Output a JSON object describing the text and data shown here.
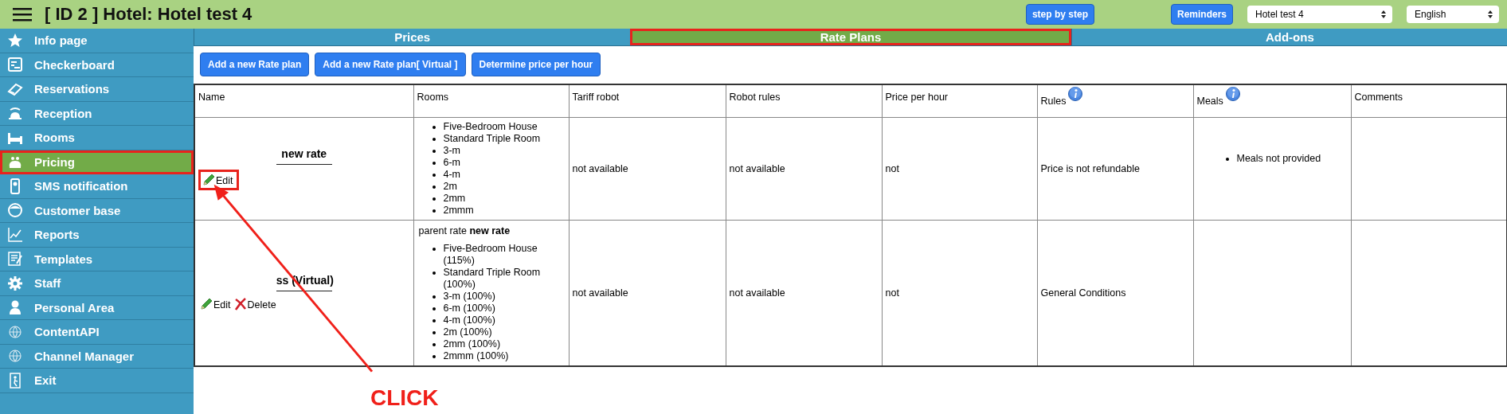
{
  "header": {
    "title": "[ ID 2 ] Hotel: Hotel test 4",
    "buttons": [
      {
        "label": "step by step"
      },
      {
        "label": "Reminders"
      }
    ],
    "selects": [
      {
        "value": "Hotel test 4"
      },
      {
        "value": "English"
      }
    ]
  },
  "sidebar": {
    "items": [
      {
        "label": "Info page",
        "selected": false,
        "highlighted": false
      },
      {
        "label": "Checkerboard",
        "selected": false,
        "highlighted": false
      },
      {
        "label": "Reservations",
        "selected": false,
        "highlighted": false
      },
      {
        "label": "Reception",
        "selected": false,
        "highlighted": false
      },
      {
        "label": "Rooms",
        "selected": false,
        "highlighted": false
      },
      {
        "label": "Pricing",
        "selected": true,
        "highlighted": true
      },
      {
        "label": "SMS notification",
        "selected": false,
        "highlighted": false
      },
      {
        "label": "Customer base",
        "selected": false,
        "highlighted": false
      },
      {
        "label": "Reports",
        "selected": false,
        "highlighted": false
      },
      {
        "label": "Templates",
        "selected": false,
        "highlighted": false
      },
      {
        "label": "Staff",
        "selected": false,
        "highlighted": false
      },
      {
        "label": "Personal Area",
        "selected": false,
        "highlighted": false
      },
      {
        "label": "ContentAPI",
        "selected": false,
        "highlighted": false
      },
      {
        "label": "Channel Manager",
        "selected": false,
        "highlighted": false
      },
      {
        "label": "Exit",
        "selected": false,
        "highlighted": false
      }
    ]
  },
  "tabs": [
    {
      "label": "Prices",
      "selected": false,
      "highlighted": false
    },
    {
      "label": "Rate Plans",
      "selected": true,
      "highlighted": true
    },
    {
      "label": "Add-ons",
      "selected": false,
      "highlighted": false
    }
  ],
  "toolbar": {
    "buttons": [
      "Add a new Rate plan",
      "Add a new Rate plan[ Virtual ]",
      "Determine price per hour"
    ]
  },
  "table": {
    "columns": [
      {
        "label": "Name",
        "info": false
      },
      {
        "label": "Rooms",
        "info": false
      },
      {
        "label": "Tariff robot",
        "info": false
      },
      {
        "label": "Robot rules",
        "info": false
      },
      {
        "label": "Price per hour",
        "info": false
      },
      {
        "label": "Rules",
        "info": true
      },
      {
        "label": "Meals",
        "info": true
      },
      {
        "label": "Comments",
        "info": false
      }
    ],
    "rows": [
      {
        "name": "new rate",
        "actions": [
          {
            "kind": "edit",
            "label": "Edit",
            "highlighted": true
          }
        ],
        "rooms": {
          "items": [
            "Five-Bedroom House",
            "Standard Triple Room",
            "3-m",
            "6-m",
            "4-m",
            "2m",
            "2mm",
            "2mmm"
          ]
        },
        "tariff_robot": "not available",
        "robot_rules": "not available",
        "price_per_hour": "not",
        "rules": "Price is not refundable",
        "meals": [
          "Meals not provided"
        ]
      },
      {
        "name": "ss (Virtual)",
        "actions": [
          {
            "kind": "edit",
            "label": "Edit",
            "highlighted": false
          },
          {
            "kind": "delete",
            "label": "Delete",
            "highlighted": false
          }
        ],
        "rooms": {
          "parent": "parent rate **new rate**",
          "items": [
            "Five-Bedroom House (115%)",
            "Standard Triple Room (100%)",
            "3-m (100%)",
            "6-m (100%)",
            "4-m (100%)",
            "2m (100%)",
            "2mm (100%)",
            "2mmm (100%)"
          ]
        },
        "tariff_robot": "not available",
        "robot_rules": "not available",
        "price_per_hour": "not",
        "rules": "General Conditions",
        "meals": []
      }
    ]
  },
  "annotation": {
    "label": "CLICK"
  }
}
